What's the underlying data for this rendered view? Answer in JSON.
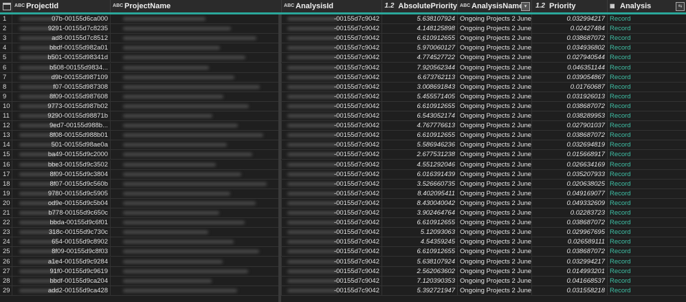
{
  "columns": {
    "projectid": {
      "type": "ABC",
      "label": "ProjectId"
    },
    "projectname": {
      "type": "ABC",
      "label": "ProjectName"
    },
    "analysisid": {
      "type": "ABC",
      "label": "AnalysisId"
    },
    "absolutepriority": {
      "type": "1.2",
      "label": "AbsolutePriority"
    },
    "analysisname": {
      "type": "ABC",
      "label": "AnalysisName"
    },
    "priority": {
      "type": "1.2",
      "label": "Priority"
    },
    "analysis": {
      "type": "table-icon",
      "label": "Analysis"
    }
  },
  "colors": {
    "accent": "#2aa79b",
    "record": "#3fbfa5",
    "background": "#1f1f1f"
  },
  "rows": [
    {
      "n": "1",
      "pid": "07b-00155d6ca000",
      "aid": "-00155d7c9042",
      "abs": "5.638107924",
      "name": "Ongoing Projects 2 June",
      "pri": "0.032994217",
      "rec": "Record"
    },
    {
      "n": "2",
      "pid": "9291-00155d7c8235",
      "aid": "-00155d7c9042",
      "abs": "4.148125898",
      "name": "Ongoing Projects 2 June",
      "pri": "0.02427484",
      "rec": "Record"
    },
    {
      "n": "3",
      "pid": "ad8-00155d7c8512",
      "aid": "-00155d7c9042",
      "abs": "6.610912655",
      "name": "Ongoing Projects 2 June",
      "pri": "0.038687072",
      "rec": "Record"
    },
    {
      "n": "4",
      "pid": "bbdf-00155d982a01",
      "aid": "-00155d7c9042",
      "abs": "5.970060127",
      "name": "Ongoing Projects 2 June",
      "pri": "0.034936802",
      "rec": "Record"
    },
    {
      "n": "5",
      "pid": "b501-00155d98341d",
      "aid": "-00155d7c9042",
      "abs": "4.774527722",
      "name": "Ongoing Projects 2 June",
      "pri": "0.027940544",
      "rec": "Record"
    },
    {
      "n": "6",
      "pid": "b508-00155d9834...",
      "aid": "-00155d7c9042",
      "abs": "7.920562344",
      "name": "Ongoing Projects 2 June",
      "pri": "0.046351144",
      "rec": "Record"
    },
    {
      "n": "7",
      "pid": "d9b-00155d987109",
      "aid": "-00155d7c9042",
      "abs": "6.673762113",
      "name": "Ongoing Projects 2 June",
      "pri": "0.039054867",
      "rec": "Record"
    },
    {
      "n": "8",
      "pid": "f07-00155d987308",
      "aid": "-00155d7c9042",
      "abs": "3.008691843",
      "name": "Ongoing Projects 2 June",
      "pri": "0.01760687",
      "rec": "Record"
    },
    {
      "n": "9",
      "pid": "8f09-00155d987608",
      "aid": "-00155d7c9042",
      "abs": "5.455571405",
      "name": "Ongoing Projects 2 June",
      "pri": "0.031926013",
      "rec": "Record"
    },
    {
      "n": "10",
      "pid": "9773-00155d987b02",
      "aid": "-00155d7c9042",
      "abs": "6.610912655",
      "name": "Ongoing Projects 2 June",
      "pri": "0.038687072",
      "rec": "Record"
    },
    {
      "n": "11",
      "pid": "9290-00155d98871b",
      "aid": "-00155d7c9042",
      "abs": "6.543052174",
      "name": "Ongoing Projects 2 June",
      "pri": "0.038289953",
      "rec": "Record"
    },
    {
      "n": "12",
      "pid": "9ed7-00155d988b...",
      "aid": "-00155d7c9042",
      "abs": "4.767776613",
      "name": "Ongoing Projects 2 June",
      "pri": "0.027901037",
      "rec": "Record"
    },
    {
      "n": "13",
      "pid": "8f08-00155d988b01",
      "aid": "-00155d7c9042",
      "abs": "6.610912655",
      "name": "Ongoing Projects 2 June",
      "pri": "0.038687072",
      "rec": "Record"
    },
    {
      "n": "14",
      "pid": "501-00155d98ae0a",
      "aid": "-00155d7c9042",
      "abs": "5.586946236",
      "name": "Ongoing Projects 2 June",
      "pri": "0.032694819",
      "rec": "Record"
    },
    {
      "n": "15",
      "pid": "ba49-00155d9c2000",
      "aid": "-00155d7c9042",
      "abs": "2.677531238",
      "name": "Ongoing Projects 2 June",
      "pri": "0.015668917",
      "rec": "Record"
    },
    {
      "n": "16",
      "pid": "bbe3-00155d9c3502",
      "aid": "-00155d7c9042",
      "abs": "4.551292046",
      "name": "Ongoing Projects 2 June",
      "pri": "0.026634169",
      "rec": "Record"
    },
    {
      "n": "17",
      "pid": "8f09-00155d9c3804",
      "aid": "-00155d7c9042",
      "abs": "6.016391439",
      "name": "Ongoing Projects 2 June",
      "pri": "0.035207933",
      "rec": "Record"
    },
    {
      "n": "18",
      "pid": "8f07-00155d9c560b",
      "aid": "-00155d7c9042",
      "abs": "3.526660735",
      "name": "Ongoing Projects 2 June",
      "pri": "0.020638025",
      "rec": "Record"
    },
    {
      "n": "19",
      "pid": "9780-00155d9c5905",
      "aid": "-00155d7c9042",
      "abs": "8.402095411",
      "name": "Ongoing Projects 2 June",
      "pri": "0.049169077",
      "rec": "Record"
    },
    {
      "n": "20",
      "pid": "od9e-00155d9c5b04",
      "aid": "-00155d7c9042",
      "abs": "8.430040042",
      "name": "Ongoing Projects 2 June",
      "pri": "0.049332609",
      "rec": "Record"
    },
    {
      "n": "21",
      "pid": "b778-00155d9c650c",
      "aid": "-00155d7c9042",
      "abs": "3.902464764",
      "name": "Ongoing Projects 2 June",
      "pri": "0.02283723",
      "rec": "Record"
    },
    {
      "n": "22",
      "pid": "bbda-00155d9c6f01",
      "aid": "-00155d7c9042",
      "abs": "6.610912655",
      "name": "Ongoing Projects 2 June",
      "pri": "0.038687072",
      "rec": "Record"
    },
    {
      "n": "23",
      "pid": "318c-00155d9c730c",
      "aid": "-00155d7c9042",
      "abs": "5.12093063",
      "name": "Ongoing Projects 2 June",
      "pri": "0.029967695",
      "rec": "Record"
    },
    {
      "n": "24",
      "pid": "654-00155d9c8902",
      "aid": "-00155d7c9042",
      "abs": "4.54359245",
      "name": "Ongoing Projects 2 June",
      "pri": "0.026589111",
      "rec": "Record"
    },
    {
      "n": "25",
      "pid": "8f09-00155d9c8f03",
      "aid": "-00155d7c9042",
      "abs": "6.610912655",
      "name": "Ongoing Projects 2 June",
      "pri": "0.038687072",
      "rec": "Record"
    },
    {
      "n": "26",
      "pid": "a1e4-00155d9c9284",
      "aid": "-00155d7c9042",
      "abs": "5.638107924",
      "name": "Ongoing Projects 2 June",
      "pri": "0.032994217",
      "rec": "Record"
    },
    {
      "n": "27",
      "pid": "91f0-00155d9c9619",
      "aid": "-00155d7c9042",
      "abs": "2.562063602",
      "name": "Ongoing Projects 2 June",
      "pri": "0.014993201",
      "rec": "Record"
    },
    {
      "n": "28",
      "pid": "bbdf-00155d9ca204",
      "aid": "-00155d7c9042",
      "abs": "7.120390353",
      "name": "Ongoing Projects 2 June",
      "pri": "0.041668537",
      "rec": "Record"
    },
    {
      "n": "29",
      "pid": "add2-00155d9ca428",
      "aid": "-00155d7c9042",
      "abs": "5.392721947",
      "name": "Ongoing Projects 2 June",
      "pri": "0.031558218",
      "rec": "Record"
    }
  ]
}
